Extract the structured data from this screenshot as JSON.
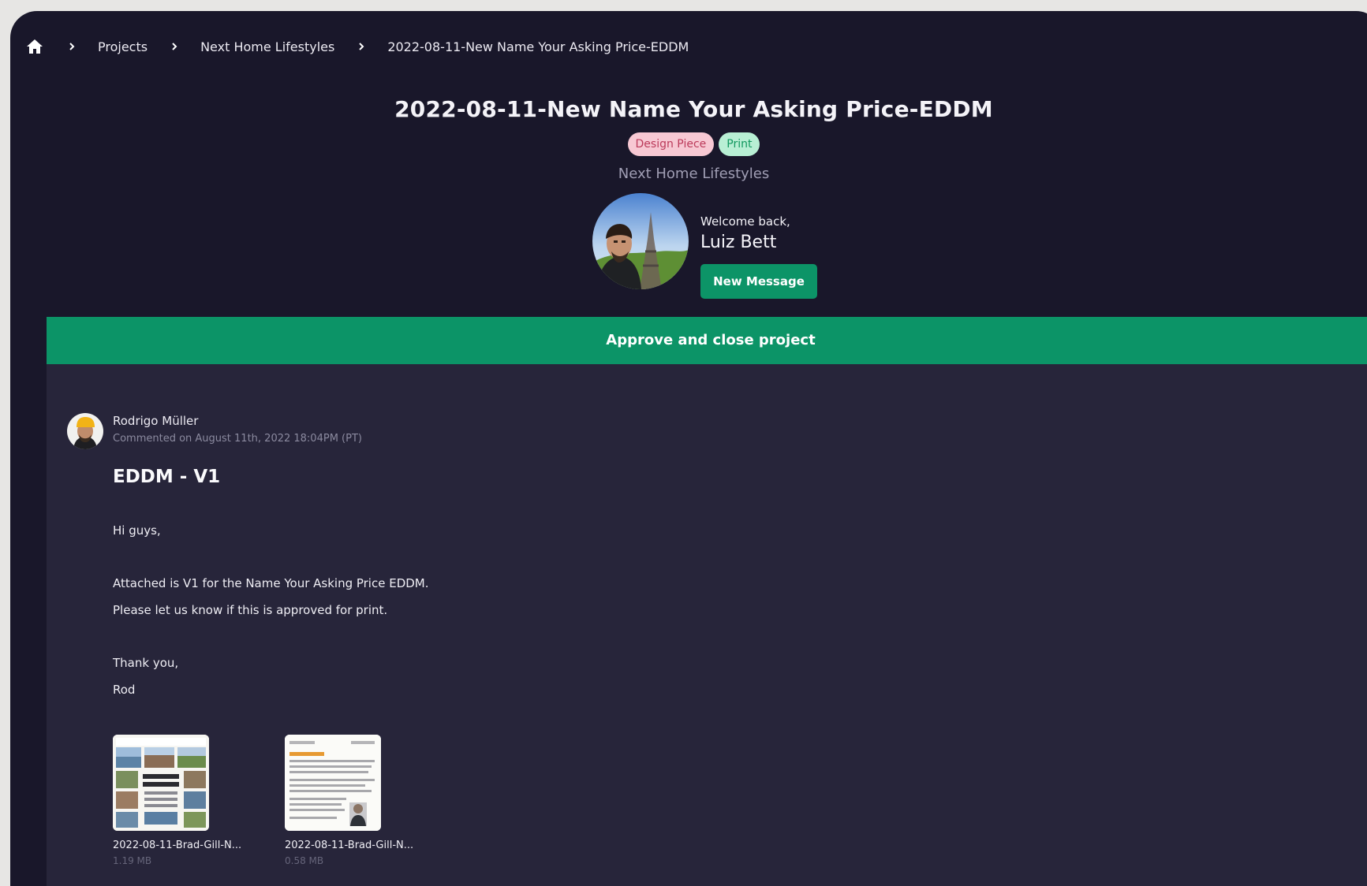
{
  "breadcrumb": {
    "home_icon": "home-icon",
    "items": [
      "Projects",
      "Next Home Lifestyles",
      "2022-08-11-New Name Your Asking Price-EDDM"
    ]
  },
  "project": {
    "title": "2022-08-11-New Name Your Asking Price-EDDM",
    "tags": [
      "Design Piece",
      "Print"
    ],
    "client": "Next Home Lifestyles"
  },
  "user": {
    "welcome": "Welcome back,",
    "name": "Luiz Bett",
    "new_message_label": "New Message"
  },
  "actions": {
    "approve_label": "Approve and close project"
  },
  "comment": {
    "author": "Rodrigo Müller",
    "timestamp": "Commented on August 11th, 2022 18:04PM (PT)",
    "title": "EDDM - V1",
    "body": [
      "Hi guys,",
      "Attached is V1 for the Name Your Asking Price EDDM.",
      "Please let us know if this is approved for print.",
      "Thank you,",
      "Rod"
    ],
    "attachments": [
      {
        "name": "2022-08-11-Brad-Gill-N...",
        "size": "1.19 MB"
      },
      {
        "name": "2022-08-11-Brad-Gill-N...",
        "size": "0.58 MB"
      }
    ]
  },
  "colors": {
    "page_background": "#e7e6e4",
    "app_background": "#19172a",
    "panel_background": "#27253a",
    "accent_green": "#0c9467",
    "design_tag_background": "#f7c8d3",
    "print_tag_background": "#b8efd4"
  }
}
